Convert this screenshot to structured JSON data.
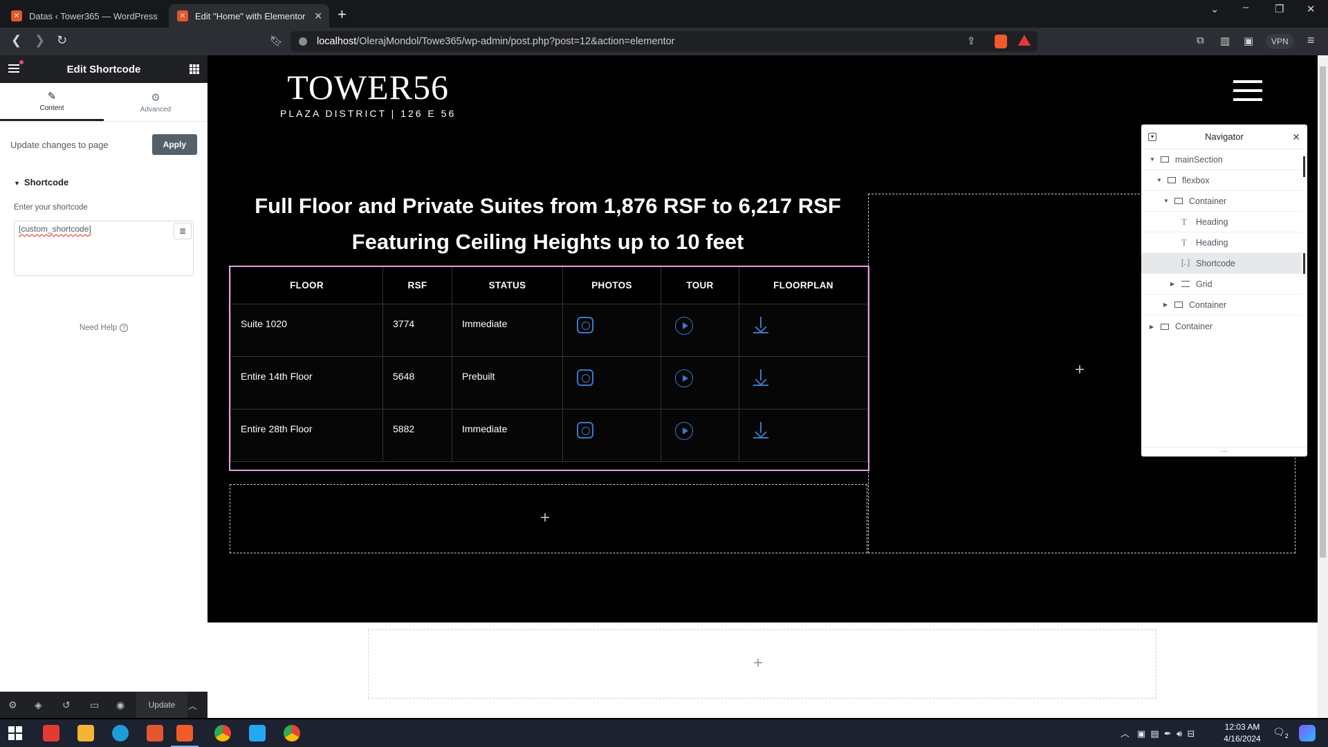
{
  "browser": {
    "tabs": [
      {
        "title": "Datas ‹ Tower365 — WordPress",
        "active": false
      },
      {
        "title": "Edit \"Home\" with Elementor",
        "active": true
      }
    ],
    "url_host": "localhost",
    "url_path": "/OlerajMondol/Towe365/wp-admin/post.php?post=12&action=elementor",
    "vpn_label": "VPN"
  },
  "panel": {
    "title": "Edit Shortcode",
    "tabs": [
      {
        "label": "Content",
        "icon": "pencil-icon",
        "active": true
      },
      {
        "label": "Advanced",
        "icon": "gear-icon",
        "active": false
      }
    ],
    "update_text": "Update changes to page",
    "apply_label": "Apply",
    "section_title": "Shortcode",
    "field_label": "Enter your shortcode",
    "field_value": "[custom_shortcode]",
    "help_text": "Need Help",
    "footer_update_label": "Update"
  },
  "canvas": {
    "logo_main": "TOWER56",
    "logo_sub": "PLAZA DISTRICT | 126 E 56",
    "headline_line1": "Full Floor and Private Suites from 1,876 RSF to 6,217 RSF",
    "headline_line2": "Featuring Ceiling Heights up to 10 feet",
    "table": {
      "headers": [
        "FLOOR",
        "RSF",
        "STATUS",
        "PHOTOS",
        "TOUR",
        "FLOORPLAN"
      ],
      "rows": [
        {
          "floor": "Suite 1020",
          "rsf": "3774",
          "status": "Immediate"
        },
        {
          "floor": "Entire 14th Floor",
          "rsf": "5648",
          "status": "Prebuilt"
        },
        {
          "floor": "Entire 28th Floor",
          "rsf": "5882",
          "status": "Immediate"
        }
      ]
    },
    "add_symbol": "+"
  },
  "navigator": {
    "title": "Navigator",
    "items": [
      {
        "label": "mainSection",
        "type": "container",
        "expanded": true
      },
      {
        "label": "flexbox",
        "type": "container",
        "expanded": true
      },
      {
        "label": "Container",
        "type": "container",
        "expanded": true
      },
      {
        "label": "Heading",
        "type": "heading"
      },
      {
        "label": "Heading",
        "type": "heading"
      },
      {
        "label": "Shortcode",
        "type": "shortcode",
        "selected": true
      },
      {
        "label": "Grid",
        "type": "grid",
        "expanded": false
      },
      {
        "label": "Container",
        "type": "container",
        "expanded": false
      },
      {
        "label": "Container",
        "type": "container",
        "expanded": false
      }
    ]
  },
  "taskbar": {
    "time": "12:03 AM",
    "date": "4/16/2024",
    "notification_count": "2"
  },
  "colors": {
    "accent_blue": "#3a78c9",
    "selection_pink": "#e6a0e0",
    "panel_dark": "#1f2124"
  }
}
